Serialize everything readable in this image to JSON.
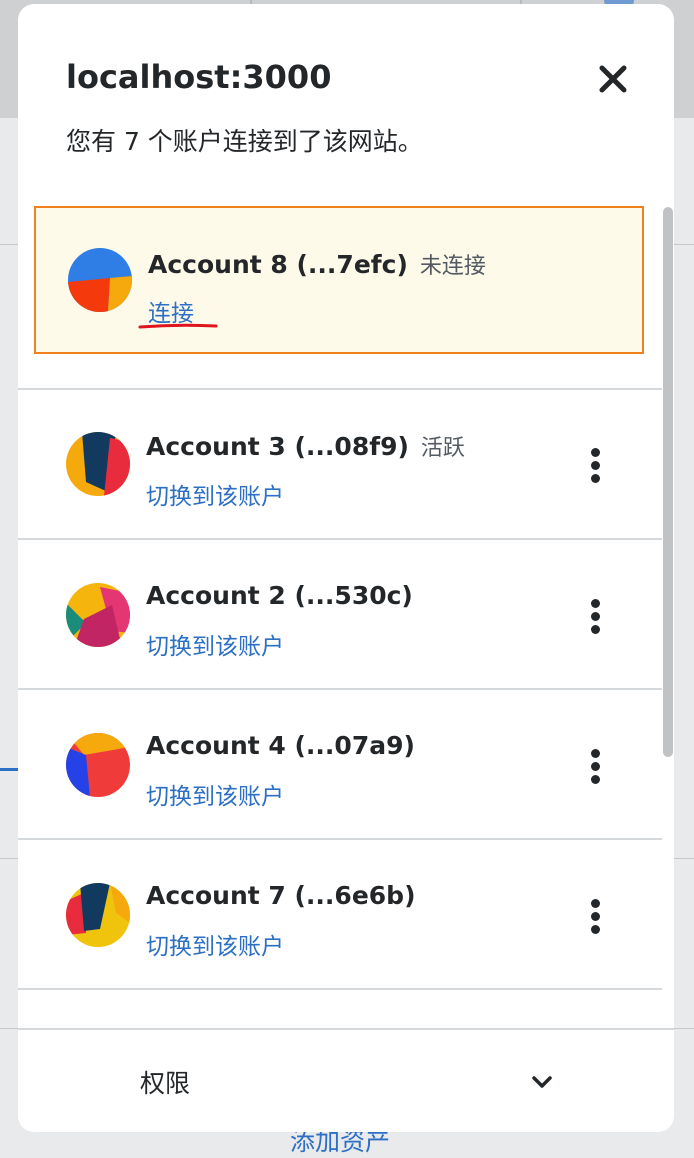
{
  "background": {
    "partial_link": "添加资产"
  },
  "modal": {
    "title": "localhost:3000",
    "subtitle": "您有 7 个账户连接到了该网站。",
    "close_icon": "close-icon"
  },
  "accounts": [
    {
      "name": "Account 8 (...7efc)",
      "status": "未连接",
      "action": "连接",
      "selected": true,
      "avatar_colors": [
        "#2f7ee6",
        "#f5a90c",
        "#f4390d"
      ]
    },
    {
      "name": "Account 3 (...08f9)",
      "status": "活跃",
      "action": "切换到该账户",
      "selected": false,
      "avatar_colors": [
        "#f5a90c",
        "#123a5e",
        "#e82c3d"
      ]
    },
    {
      "name": "Account 2 (...530c)",
      "status": "",
      "action": "切换到该账户",
      "selected": false,
      "avatar_colors": [
        "#f5b50c",
        "#e33673",
        "#c22564",
        "#1c8c7a"
      ]
    },
    {
      "name": "Account 4 (...07a9)",
      "status": "",
      "action": "切换到该账户",
      "selected": false,
      "avatar_colors": [
        "#f03b3b",
        "#f5a90c",
        "#2542e8"
      ]
    },
    {
      "name": "Account 7 (...6e6b)",
      "status": "",
      "action": "切换到该账户",
      "selected": false,
      "avatar_colors": [
        "#f0c40c",
        "#123a5e",
        "#e82c3d",
        "#f5a90c"
      ]
    }
  ],
  "footer": {
    "label": "权限",
    "toggle_icon": "chevron-down-icon"
  },
  "colors": {
    "accent": "#2c6fc4",
    "selected_border": "#f0811b",
    "selected_bg": "#fefaea",
    "annotation_red": "#e0141e"
  }
}
